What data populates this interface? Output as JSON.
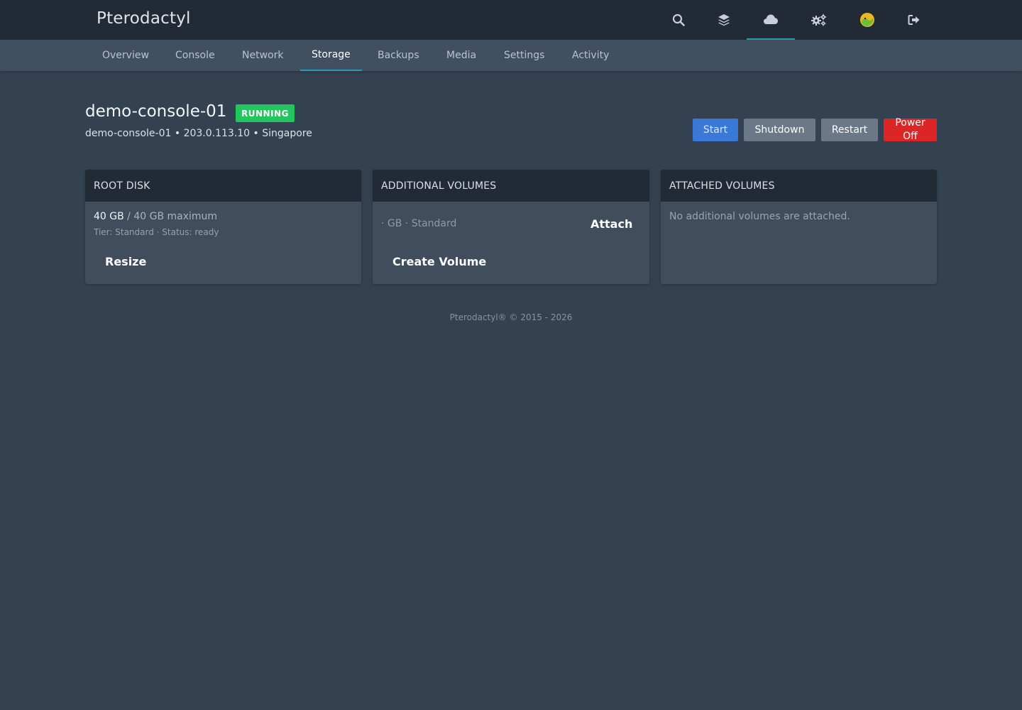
{
  "app": {
    "brand": "Pterodactyl"
  },
  "topnav": {
    "icons": [
      "search-icon",
      "layers-icon",
      "cloud-icon",
      "settings-gears-icon",
      "avatar",
      "logout-icon"
    ],
    "active": "cloud-icon"
  },
  "tabs": [
    {
      "label": "Overview"
    },
    {
      "label": "Console"
    },
    {
      "label": "Network"
    },
    {
      "label": "Storage",
      "active": true
    },
    {
      "label": "Backups"
    },
    {
      "label": "Media"
    },
    {
      "label": "Settings"
    },
    {
      "label": "Activity"
    }
  ],
  "server": {
    "name": "demo-console-01",
    "status": "RUNNING",
    "hostname": "demo-console-01",
    "ip": "203.0.113.10",
    "location": "Singapore",
    "separator": "•"
  },
  "power": {
    "start": "Start",
    "shutdown": "Shutdown",
    "restart": "Restart",
    "power_off": "Power Off"
  },
  "root_disk": {
    "title": "ROOT DISK",
    "size": "40 GB",
    "maximum": "/ 40 GB maximum",
    "meta": "Tier: Standard · Status: ready",
    "resize": "Resize"
  },
  "additional_volumes": {
    "title": "ADDITIONAL VOLUMES",
    "entry": "· GB · Standard",
    "attach": "Attach",
    "create": "Create Volume"
  },
  "attached_volumes": {
    "title": "ATTACHED VOLUMES",
    "empty": "No additional volumes are attached."
  },
  "footer": {
    "text": "Pterodactyl® © 2015 - 2026"
  },
  "colors": {
    "background": "#334150",
    "topbar": "#212a35",
    "accent": "#2a9bb6",
    "running": "#22c55e",
    "start": "#3a79d8",
    "danger": "#dc2626"
  }
}
